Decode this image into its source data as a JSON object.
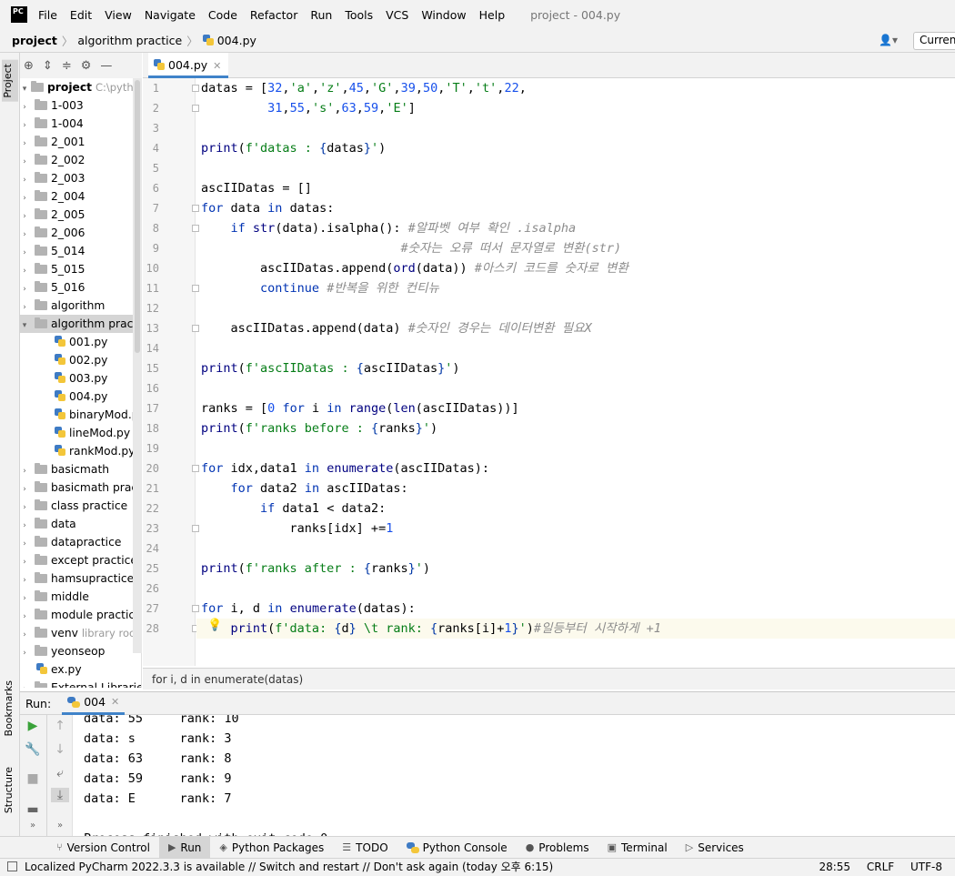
{
  "menu": {
    "items": [
      "File",
      "Edit",
      "View",
      "Navigate",
      "Code",
      "Refactor",
      "Run",
      "Tools",
      "VCS",
      "Window",
      "Help"
    ],
    "window_title": "project - 004.py"
  },
  "nav": {
    "project": "project",
    "folder": "algorithm practice",
    "file": "004.py",
    "run_config": "Current File"
  },
  "left_tabs": {
    "project": "Project",
    "bookmarks": "Bookmarks",
    "structure": "Structure"
  },
  "tree": {
    "root_name": "project",
    "root_path": "C:\\pythonEx",
    "items": [
      {
        "label": "1-003",
        "type": "folder"
      },
      {
        "label": "1-004",
        "type": "folder"
      },
      {
        "label": "2_001",
        "type": "folder"
      },
      {
        "label": "2_002",
        "type": "folder"
      },
      {
        "label": "2_003",
        "type": "folder"
      },
      {
        "label": "2_004",
        "type": "folder"
      },
      {
        "label": "2_005",
        "type": "folder"
      },
      {
        "label": "2_006",
        "type": "folder"
      },
      {
        "label": "5_014",
        "type": "folder"
      },
      {
        "label": "5_015",
        "type": "folder"
      },
      {
        "label": "5_016",
        "type": "folder"
      },
      {
        "label": "algorithm",
        "type": "folder"
      },
      {
        "label": "algorithm practice",
        "type": "folder-open"
      },
      {
        "label": "001.py",
        "type": "file"
      },
      {
        "label": "002.py",
        "type": "file"
      },
      {
        "label": "003.py",
        "type": "file"
      },
      {
        "label": "004.py",
        "type": "file"
      },
      {
        "label": "binaryMod.py",
        "type": "file"
      },
      {
        "label": "lineMod.py",
        "type": "file"
      },
      {
        "label": "rankMod.py",
        "type": "file"
      },
      {
        "label": "basicmath",
        "type": "folder"
      },
      {
        "label": "basicmath practice",
        "type": "folder"
      },
      {
        "label": "class practice",
        "type": "folder"
      },
      {
        "label": "data",
        "type": "folder"
      },
      {
        "label": "datapractice",
        "type": "folder"
      },
      {
        "label": "except practice",
        "type": "folder"
      },
      {
        "label": "hamsupractice",
        "type": "folder"
      },
      {
        "label": "middle",
        "type": "folder"
      },
      {
        "label": "module practice",
        "type": "folder"
      },
      {
        "label": "venv",
        "type": "folder",
        "suffix": "library root"
      },
      {
        "label": "yeonseop",
        "type": "folder"
      },
      {
        "label": "ex.py",
        "type": "rootfile"
      },
      {
        "label": "External Libraries",
        "type": "lib"
      }
    ]
  },
  "editor": {
    "tab_label": "004.py",
    "breadcrumb": "for i, d in enumerate(datas)",
    "line_numbers": [
      "1",
      "2",
      "3",
      "4",
      "5",
      "6",
      "7",
      "8",
      "9",
      "10",
      "11",
      "12",
      "13",
      "14",
      "15",
      "16",
      "17",
      "18",
      "19",
      "20",
      "21",
      "22",
      "23",
      "24",
      "25",
      "26",
      "27",
      "28"
    ]
  },
  "run": {
    "label": "Run:",
    "tab": "004",
    "output": [
      "data: 55     rank: 10",
      "data: s      rank: 3",
      "data: 63     rank: 8",
      "data: 59     rank: 9",
      "data: E      rank: 7",
      "",
      "Process finished with exit code 0"
    ]
  },
  "bottom_tabs": [
    {
      "label": "Version Control",
      "icon": "branch-icon"
    },
    {
      "label": "Run",
      "icon": "run-icon"
    },
    {
      "label": "Python Packages",
      "icon": "packages-icon"
    },
    {
      "label": "TODO",
      "icon": "todo-icon"
    },
    {
      "label": "Python Console",
      "icon": "python-icon"
    },
    {
      "label": "Problems",
      "icon": "problems-icon"
    },
    {
      "label": "Terminal",
      "icon": "terminal-icon"
    },
    {
      "label": "Services",
      "icon": "services-icon"
    }
  ],
  "status": {
    "message": "Localized PyCharm 2022.3.3 is available // Switch and restart // Don't ask again (today 오후 6:15)",
    "position": "28:55",
    "line_sep": "CRLF",
    "encoding": "UTF-8"
  }
}
